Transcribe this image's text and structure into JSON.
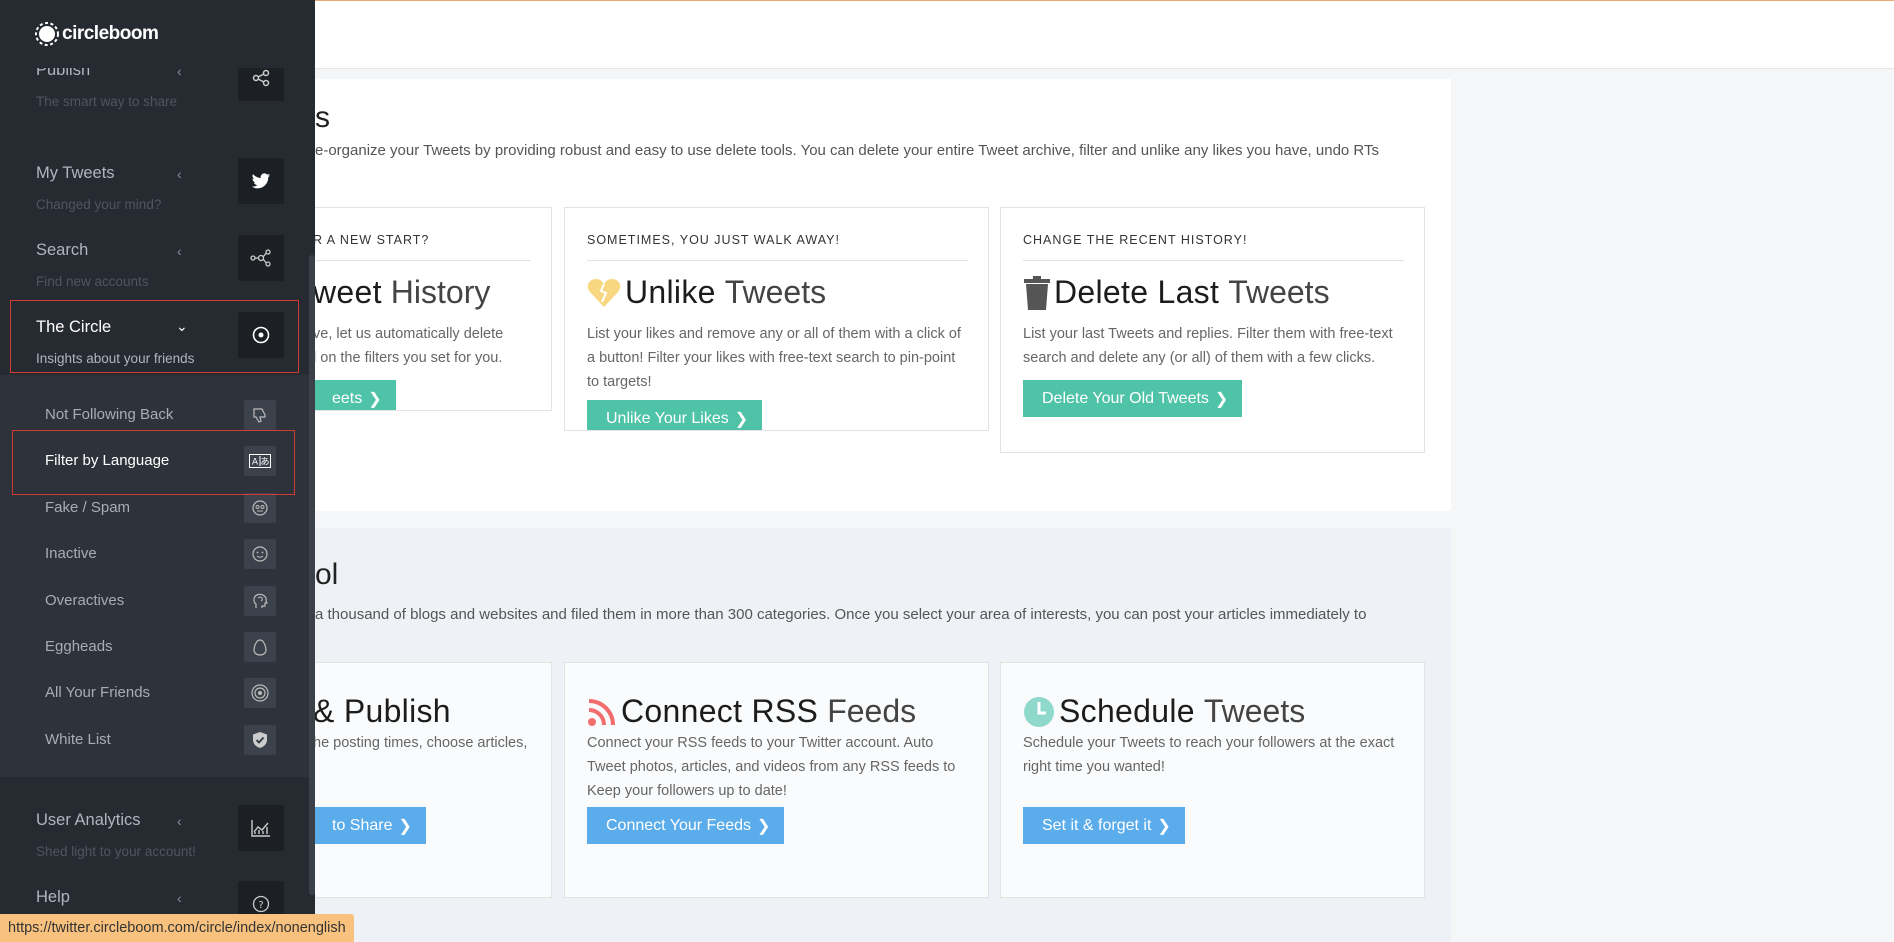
{
  "sidebar": {
    "logo_text": "circleboom",
    "menu": [
      {
        "label": "Publish",
        "sub": "The smart way to share",
        "icon": "share-icon"
      },
      {
        "label": "My Tweets",
        "sub": "Changed your mind?",
        "icon": "twitter-bird-icon"
      },
      {
        "label": "Search",
        "sub": "Find new accounts",
        "icon": "network-nodes-icon"
      },
      {
        "label": "The Circle",
        "sub": "Insights about your friends",
        "icon": "target-circle-icon"
      },
      {
        "label": "User Analytics",
        "sub": "Shed light to your account!",
        "icon": "line-chart-icon"
      },
      {
        "label": "Help",
        "sub": "",
        "icon": "question-circle-icon"
      }
    ],
    "circle_items": [
      {
        "label": "Not Following Back",
        "icon": "thumbs-down-icon"
      },
      {
        "label": "Filter by Language",
        "icon": "translate-icon"
      },
      {
        "label": "Fake / Spam",
        "icon": "robot-face-icon"
      },
      {
        "label": "Inactive",
        "icon": "smiley-icon"
      },
      {
        "label": "Overactives",
        "icon": "brain-head-icon"
      },
      {
        "label": "Eggheads",
        "icon": "egg-icon"
      },
      {
        "label": "All Your Friends",
        "icon": "concentric-circles-icon"
      },
      {
        "label": "White List",
        "icon": "shield-check-icon"
      }
    ]
  },
  "section1": {
    "title": "s",
    "desc": "e-organize your Tweets by providing robust and easy to use delete tools. You can delete your entire Tweet archive, filter and unlike any likes you have, undo RTs",
    "cards": [
      {
        "eyebrow": "R A NEW START?",
        "title_bold": "weet",
        "title_light": "History",
        "desc": "ve, let us automatically delete\nl on the filters you set for you.",
        "button": "eets"
      },
      {
        "eyebrow": "SOMETIMES, YOU JUST WALK AWAY!",
        "title_bold": "Unlike",
        "title_light": "Tweets",
        "desc": "List your likes and remove any or all of them with a click of a button! Filter your likes with free-text search to pin-point to targets!",
        "button": "Unlike Your Likes"
      },
      {
        "eyebrow": "CHANGE THE RECENT HISTORY!",
        "title_bold": "Delete Last",
        "title_light": "Tweets",
        "desc": "List your last Tweets and replies. Filter them with free-text search and delete any (or all) of them with a few clicks.",
        "button": "Delete Your Old Tweets"
      }
    ]
  },
  "section2": {
    "title": "ol",
    "desc": "a thousand of blogs and websites and filed them in more than 300 categories. Once you select your area of interests, you can post your articles immediately to",
    "cards": [
      {
        "title_bold": "& Publish",
        "title_light": "",
        "desc": "he posting times, choose articles,",
        "button": "to Share"
      },
      {
        "title_bold": "Connect RSS",
        "title_light": "Feeds",
        "desc": "Connect your RSS feeds to your Twitter account. Auto Tweet photos, articles, and videos from any RSS feeds to Keep your followers up to date!",
        "button": "Connect Your Feeds"
      },
      {
        "title_bold": "Schedule",
        "title_light": "Tweets",
        "desc": "Schedule your Tweets to reach your followers at the exact right time you wanted!",
        "button": "Set it & forget it"
      }
    ]
  },
  "status_url": "https://twitter.circleboom.com/circle/index/nonenglish",
  "colors": {
    "sidebar_bg": "#262a31",
    "submenu_bg": "#2e333b",
    "teal_button": "#4fc3a8",
    "blue_button": "#5aacea",
    "highlight_red": "#d03a32",
    "status_bar": "#f8c27e"
  }
}
